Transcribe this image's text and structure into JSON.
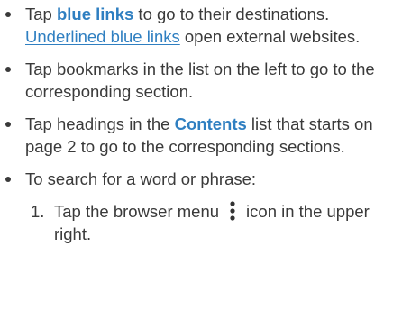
{
  "items": [
    {
      "link_text": "blue links",
      "pre": "Tap ",
      "post": " to go to their destinations. ",
      "underline_text": "Underlined blue links",
      "tail": " open external websites."
    },
    {
      "text": "Tap bookmarks in the list on the left to go to the corresponding section."
    },
    {
      "pre": "Tap headings in the ",
      "link_text": "Contents",
      "post": " list that starts on page 2 to go to the corresponding sections."
    },
    {
      "text": "To search for a word or phrase:",
      "steps": [
        {
          "marker": "1.",
          "pre": "Tap the browser menu",
          "icon": "kebab-menu-icon",
          "post": "icon in the upper right."
        }
      ]
    }
  ],
  "colors": {
    "text": "#3a3a3a",
    "link": "#2f7fc1"
  }
}
